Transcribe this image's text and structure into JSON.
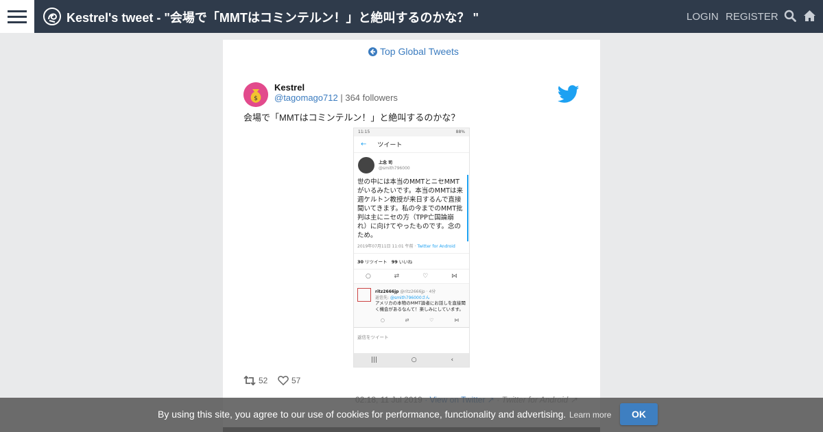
{
  "header": {
    "title": "Kestrel's tweet - \"会場で「MMTはコミンテルン！」と絶叫するのかな？ \"",
    "login_label": "LOGIN",
    "register_label": "REGISTER",
    "icons": [
      "menu-icon",
      "site-logo-icon",
      "search-icon",
      "home-icon"
    ],
    "bar_color": "#2f3b4b"
  },
  "nav": {
    "back_label": "Top Global Tweets"
  },
  "tweet": {
    "author_name": "Kestrel",
    "author_handle": "@tagomago712",
    "author_followers": "| 364 followers",
    "text": "会場で「MMTはコミンテルン！」と絶叫するのかな？",
    "retweets": "52",
    "likes": "57",
    "datetime": "02:18, 11 Jul 2019",
    "view_link": "· View on Twitter",
    "via": "· Twitter for Android",
    "accent_color": "#3a7bbf"
  },
  "media": {
    "status_time": "11:15",
    "status_battery": "88%",
    "screen_title": "ツイート",
    "user_name": "上念 司",
    "user_handle": "@smith796000",
    "body": "世の中には本当のMMTとニセMMTがいるみたいです。本当のMMTは来週ケルトン教授が来日するんで直接聞いてきます。私の今までのMMT批判は主にニセの方（TPP亡国論崩れ）に向けてやったものです。念のため。",
    "date": "2019年07月11日 11:01 午前 ·",
    "client": "Twitter for Android",
    "retweet_count": "30",
    "retweet_label": "リツイート",
    "like_count": "99",
    "like_label": "いいね",
    "reply_user": "ritz2666jp",
    "reply_meta": "@ritz2666jp · 4分",
    "reply_to_label": "返信先:",
    "reply_to_handle": "@smith796000さん",
    "reply_text": "アメリカの本物のMMT論者にお話しを直接聞く機会があるなんて！楽しみにしています。",
    "compose_placeholder": "返信をツイート"
  },
  "cookie": {
    "message": "By using this site, you agree to our use of cookies for performance, functionality and advertising.",
    "learn_more": "Learn more",
    "ok_label": "OK",
    "button_color": "#3e7fc1"
  }
}
